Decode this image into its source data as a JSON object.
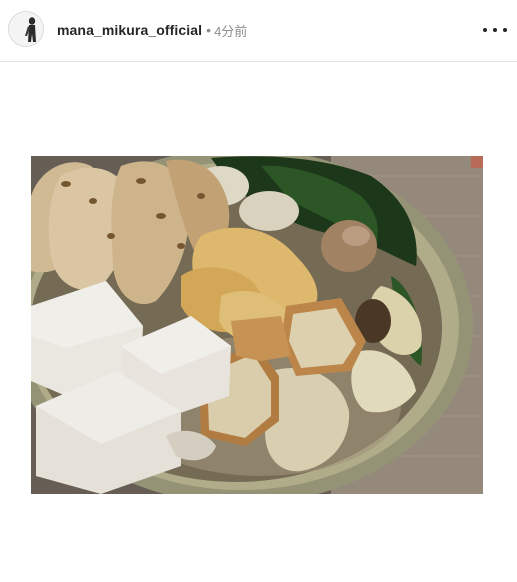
{
  "post": {
    "username": "mana_mikura_official",
    "separator": "•",
    "time": "4分前"
  },
  "icons": {
    "avatar": "avatar-icon",
    "more": "more-options-icon"
  },
  "colors": {
    "text_primary": "#262626",
    "text_secondary": "#8e8e8e",
    "divider": "#e3e3e3"
  }
}
